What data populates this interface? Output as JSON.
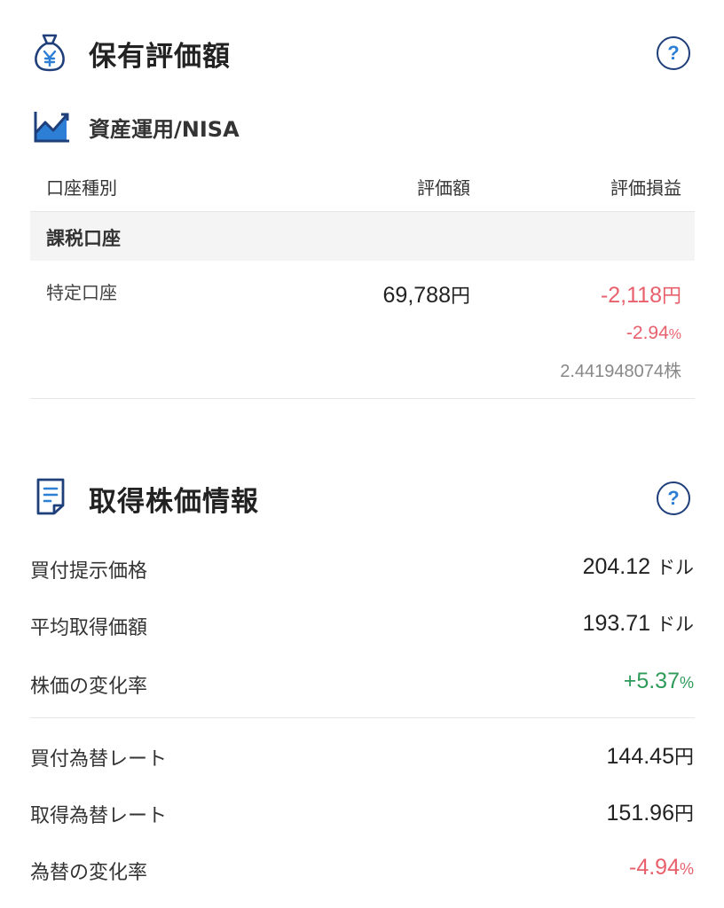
{
  "holding": {
    "title": "保有評価額",
    "help": "?",
    "category": "資産運用/NISA",
    "table": {
      "headers": [
        "口座種別",
        "評価額",
        "評価損益"
      ],
      "group": "課税口座",
      "rows": [
        {
          "account": "特定口座",
          "value_num": "69,788",
          "value_unit": "円",
          "pl_num": "-2,118",
          "pl_unit": "円",
          "pl_pct_num": "-2.94",
          "pl_pct_unit": "%",
          "shares_num": "2.441948074",
          "shares_unit": "株"
        }
      ]
    }
  },
  "acquisition": {
    "title": "取得株価情報",
    "help": "?",
    "rows": [
      {
        "label": "買付提示価格",
        "value": "204.12",
        "unit": "ドル"
      },
      {
        "label": "平均取得価額",
        "value": "193.71",
        "unit": "ドル"
      },
      {
        "label": "株価の変化率",
        "value": "+5.37",
        "unit": "%"
      },
      {
        "label": "買付為替レート",
        "value": "144.45",
        "unit": "円"
      },
      {
        "label": "取得為替レート",
        "value": "151.96",
        "unit": "円"
      },
      {
        "label": "為替の変化率",
        "value": "-4.94",
        "unit": "%"
      }
    ]
  },
  "colors": {
    "negative": "#e8606c",
    "positive": "#2e9b5a",
    "accent": "#2d7fd6",
    "navy": "#1e3f7a"
  },
  "icons": {
    "holding": "money-bag-yen-icon",
    "category": "line-chart-icon",
    "acquisition": "document-icon",
    "help": "question-circle-icon"
  }
}
